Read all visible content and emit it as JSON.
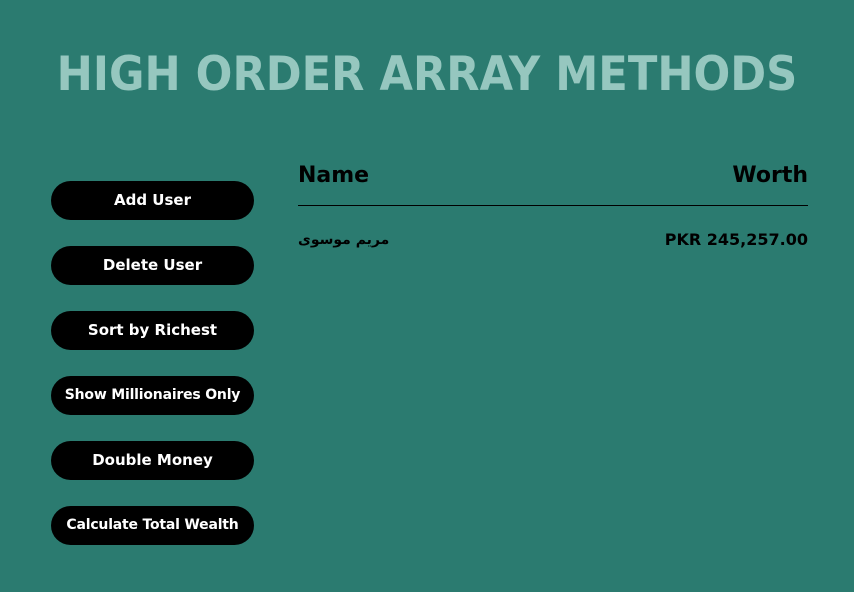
{
  "title": "HIGH ORDER ARRAY METHODS",
  "buttons": {
    "add_user": "Add User",
    "delete_user": "Delete User",
    "sort_richest": "Sort by Richest",
    "show_millionaires": "Show Millionaires Only",
    "double_money": "Double Money",
    "calculate_wealth": "Calculate Total Wealth"
  },
  "table": {
    "headers": {
      "name": "Name",
      "worth": "Worth"
    },
    "rows": [
      {
        "name": "مریم موسوی",
        "worth": "PKR 245,257.00"
      }
    ]
  },
  "colors": {
    "background": "#2b7b70",
    "title": "#96c7bf",
    "button_bg": "#000000",
    "button_text": "#ffffff"
  }
}
